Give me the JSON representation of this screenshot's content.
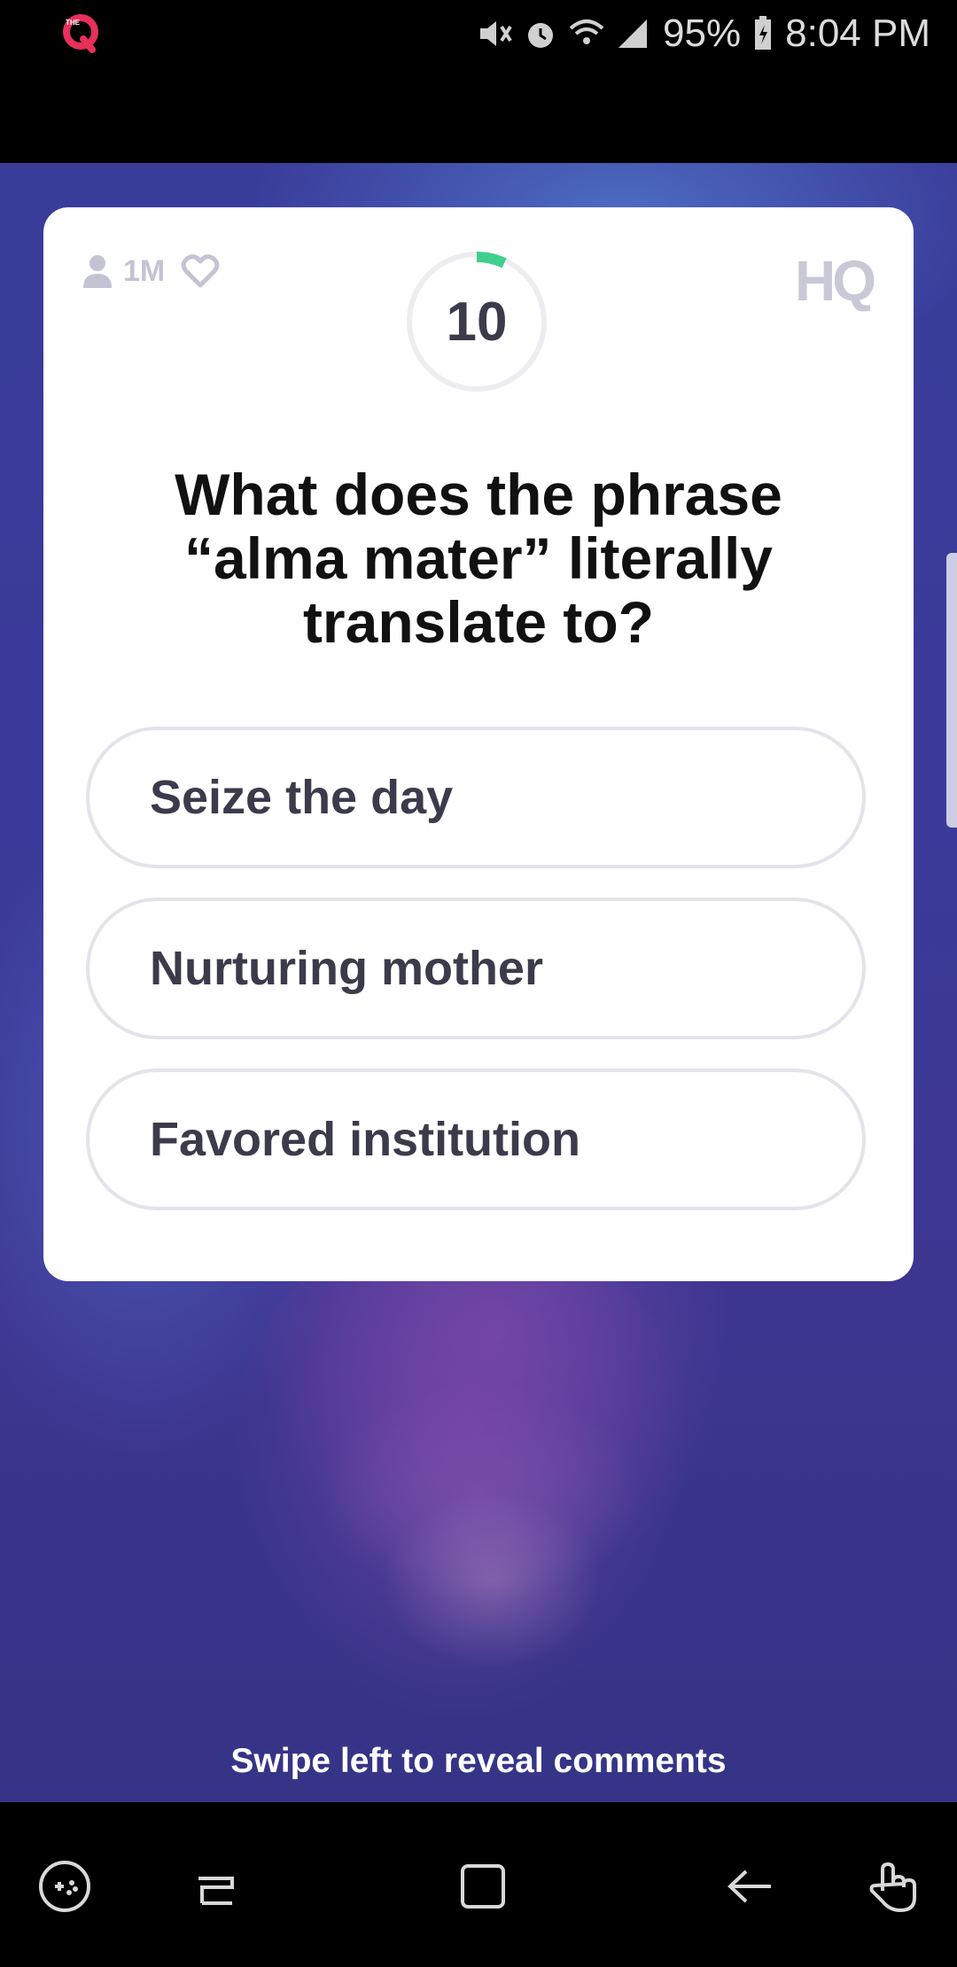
{
  "status_bar": {
    "battery": "95%",
    "time": "8:04 PM",
    "icons": [
      "hq-app-icon",
      "mute-icon",
      "alarm-icon",
      "wifi-icon",
      "signal-icon",
      "battery-charging-icon"
    ]
  },
  "card": {
    "viewer_count": "1M",
    "timer": "10",
    "timer_progress": 0.07,
    "logo": "HQ",
    "question": "What does the phrase “alma mater” literally translate to?",
    "answers": [
      {
        "label": "Seize the day"
      },
      {
        "label": "Nurturing mother"
      },
      {
        "label": "Favored institution"
      }
    ]
  },
  "swipe_hint": "Swipe left to reveal comments",
  "colors": {
    "timer_progress": "#3ecf8e",
    "card_bg": "#ffffff",
    "answer_border": "#e4e3ec",
    "background": "#3a3c9a"
  },
  "nav_bar": {
    "icons": [
      "game-launcher-icon",
      "recents-icon",
      "home-icon",
      "back-icon",
      "gesture-icon"
    ]
  }
}
